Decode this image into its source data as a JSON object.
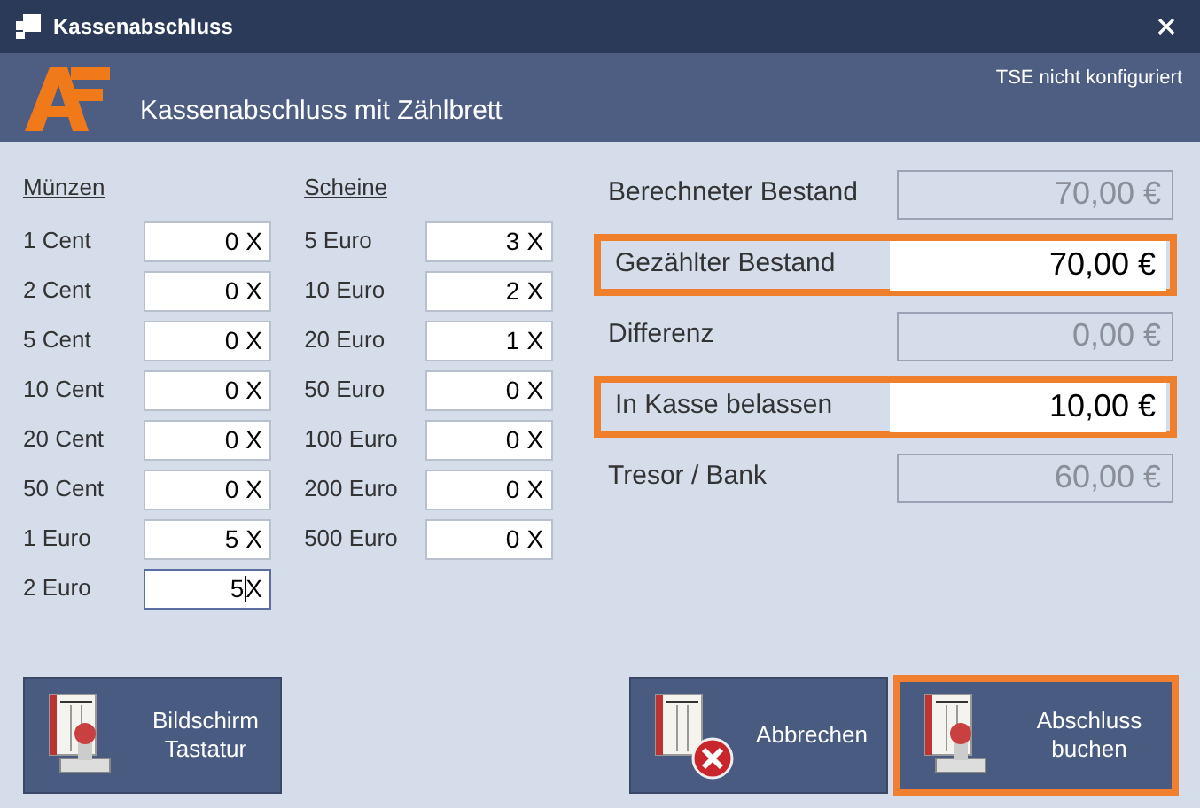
{
  "window": {
    "title": "Kassenabschluss"
  },
  "header": {
    "title": "Kassenabschluss mit Zählbrett",
    "status": "TSE nicht konfiguriert"
  },
  "coins": {
    "heading": "Münzen",
    "rows": [
      {
        "label": "1 Cent",
        "value": "0",
        "unit": "X",
        "focused": false
      },
      {
        "label": "2 Cent",
        "value": "0",
        "unit": "X",
        "focused": false
      },
      {
        "label": "5 Cent",
        "value": "0",
        "unit": "X",
        "focused": false
      },
      {
        "label": "10 Cent",
        "value": "0",
        "unit": "X",
        "focused": false
      },
      {
        "label": "20 Cent",
        "value": "0",
        "unit": "X",
        "focused": false
      },
      {
        "label": "50 Cent",
        "value": "0",
        "unit": "X",
        "focused": false
      },
      {
        "label": "1 Euro",
        "value": "5",
        "unit": "X",
        "focused": false
      },
      {
        "label": "2 Euro",
        "value": "5",
        "unit": "X",
        "focused": true
      }
    ]
  },
  "notes": {
    "heading": "Scheine",
    "rows": [
      {
        "label": "5 Euro",
        "value": "3",
        "unit": "X",
        "focused": false
      },
      {
        "label": "10 Euro",
        "value": "2",
        "unit": "X",
        "focused": false
      },
      {
        "label": "20 Euro",
        "value": "1",
        "unit": "X",
        "focused": false
      },
      {
        "label": "50 Euro",
        "value": "0",
        "unit": "X",
        "focused": false
      },
      {
        "label": "100 Euro",
        "value": "0",
        "unit": "X",
        "focused": false
      },
      {
        "label": "200 Euro",
        "value": "0",
        "unit": "X",
        "focused": false
      },
      {
        "label": "500 Euro",
        "value": "0",
        "unit": "X",
        "focused": false
      }
    ]
  },
  "totals": [
    {
      "label": "Berechneter Bestand",
      "value": "70,00 €",
      "editable": false
    },
    {
      "label": "Gezählter Bestand",
      "value": "70,00 €",
      "editable": true
    },
    {
      "label": "Differenz",
      "value": "0,00 €",
      "editable": false
    },
    {
      "label": "In Kasse belassen",
      "value": "10,00 €",
      "editable": true
    },
    {
      "label": "Tresor / Bank",
      "value": "60,00 €",
      "editable": false
    }
  ],
  "buttons": [
    {
      "label": "Bildschirm Tastatur",
      "kind": "stamp",
      "selected": false
    },
    {
      "label": "Abbrechen",
      "kind": "cancel",
      "selected": false
    },
    {
      "label": "Abschluss buchen",
      "kind": "stamp",
      "selected": true
    }
  ]
}
